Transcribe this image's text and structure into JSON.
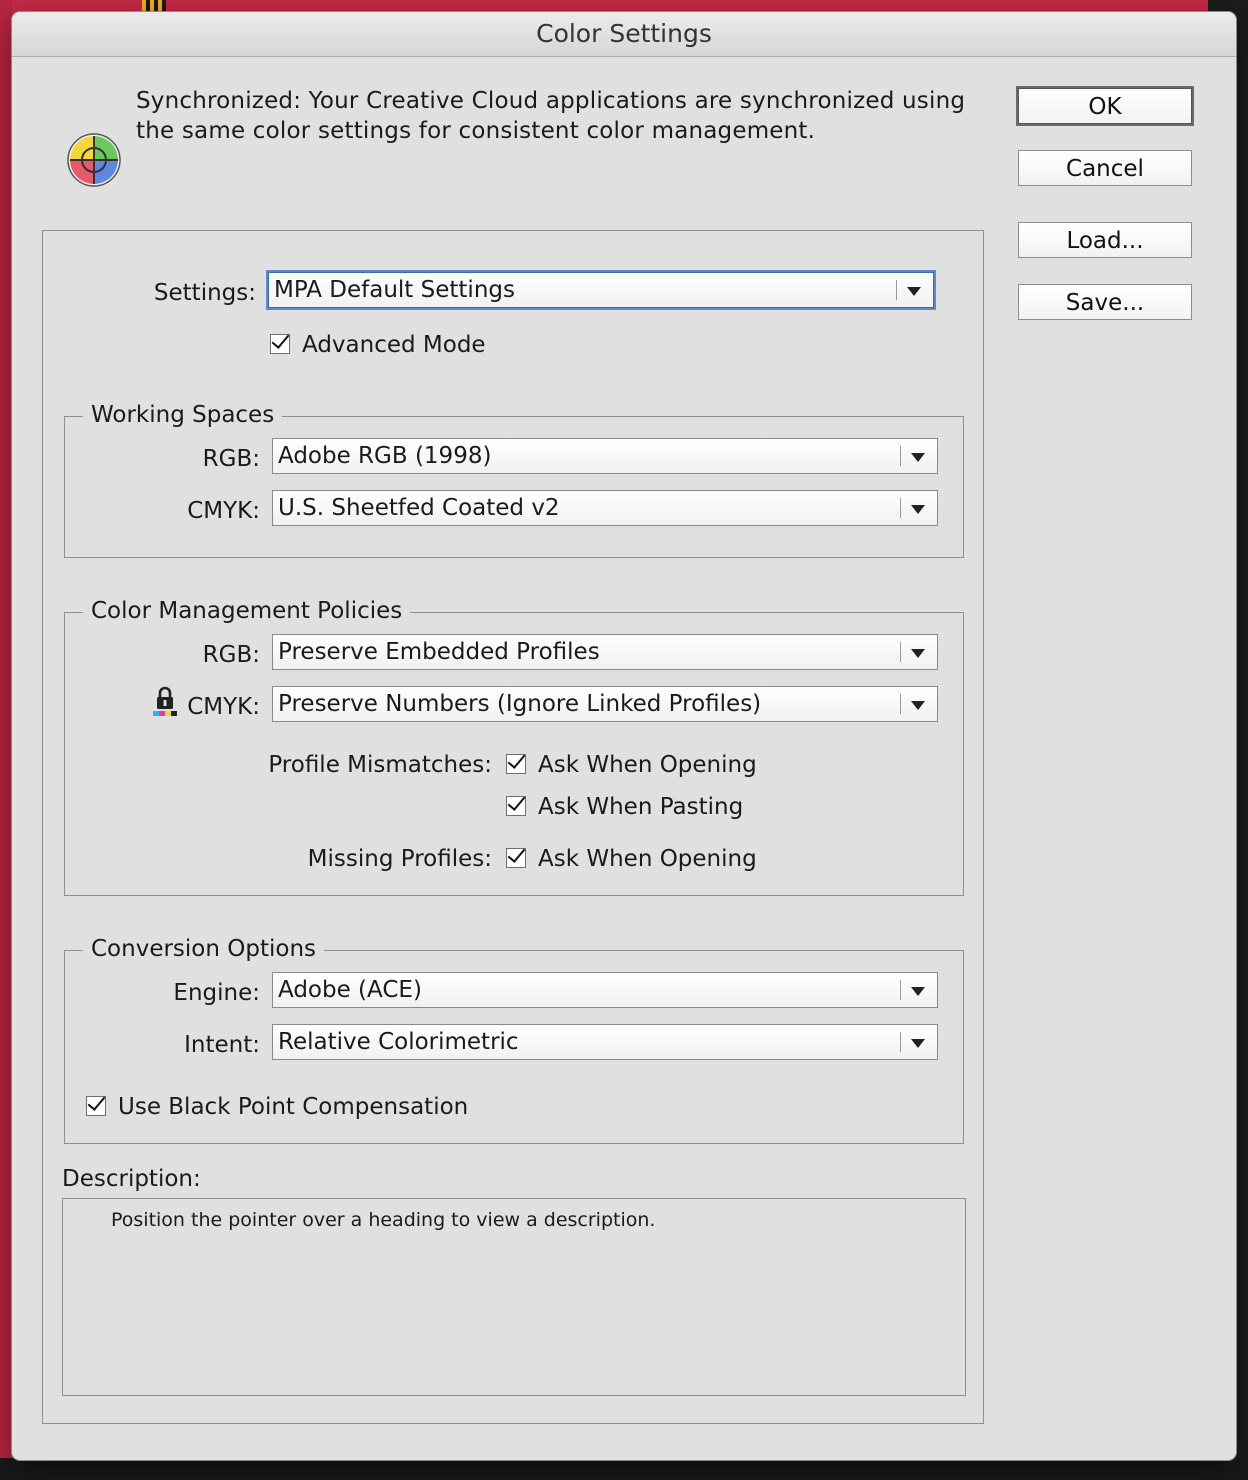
{
  "window": {
    "title": "Color Settings"
  },
  "sync": {
    "icon": "color-wheel-icon",
    "message": "Synchronized: Your Creative Cloud applications are synchronized using the same color settings for consistent color management."
  },
  "buttons": {
    "ok": "OK",
    "cancel": "Cancel",
    "load": "Load...",
    "save": "Save..."
  },
  "settings": {
    "label": "Settings:",
    "value": "MPA Default Settings",
    "advanced_mode_label": "Advanced Mode",
    "advanced_mode_checked": true
  },
  "working_spaces": {
    "title": "Working Spaces",
    "rgb_label": "RGB:",
    "rgb_value": "Adobe RGB (1998)",
    "cmyk_label": "CMYK:",
    "cmyk_value": "U.S. Sheetfed Coated v2"
  },
  "policies": {
    "title": "Color Management Policies",
    "rgb_label": "RGB:",
    "rgb_value": "Preserve Embedded Profiles",
    "cmyk_label": "CMYK:",
    "cmyk_value": "Preserve Numbers (Ignore Linked Profiles)",
    "cmyk_icon": "lock-icon",
    "profile_mismatches_label": "Profile Mismatches:",
    "mismatch_opening_label": "Ask When Opening",
    "mismatch_opening_checked": true,
    "mismatch_pasting_label": "Ask When Pasting",
    "mismatch_pasting_checked": true,
    "missing_profiles_label": "Missing Profiles:",
    "missing_opening_label": "Ask When Opening",
    "missing_opening_checked": true
  },
  "conversion": {
    "title": "Conversion Options",
    "engine_label": "Engine:",
    "engine_value": "Adobe (ACE)",
    "intent_label": "Intent:",
    "intent_value": "Relative Colorimetric",
    "bpc_label": "Use Black Point Compensation",
    "bpc_checked": true
  },
  "description": {
    "label": "Description:",
    "text": "Position the pointer over a heading to view a description."
  }
}
